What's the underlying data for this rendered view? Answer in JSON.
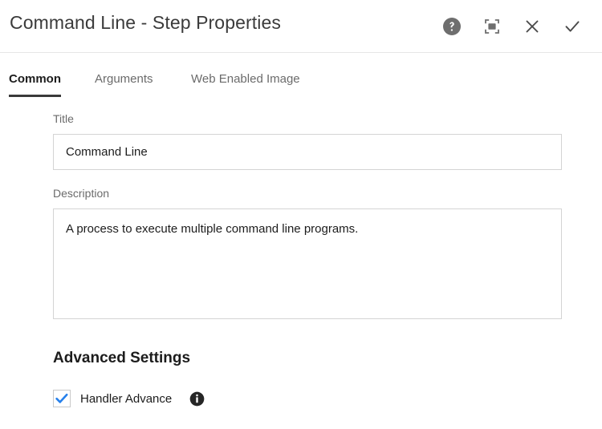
{
  "header": {
    "title": "Command Line - Step Properties",
    "actions": [
      {
        "name": "help-icon",
        "label": "Help"
      },
      {
        "name": "maximize-icon",
        "label": "Maximize"
      },
      {
        "name": "close-icon",
        "label": "Close"
      },
      {
        "name": "confirm-check-icon",
        "label": "Apply"
      }
    ]
  },
  "tabs": [
    {
      "label": "Common",
      "active": true
    },
    {
      "label": "Arguments",
      "active": false
    },
    {
      "label": "Web Enabled Image",
      "active": false
    }
  ],
  "form": {
    "title_label": "Title",
    "title_value": "Command Line",
    "title_placeholder": "",
    "description_label": "Description",
    "description_value": "A process to execute multiple command line programs.",
    "description_placeholder": ""
  },
  "advanced": {
    "heading": "Advanced Settings",
    "handler_advance_label": "Handler Advance",
    "handler_advance_checked": true,
    "info_tooltip_icon": "info-icon"
  },
  "colors": {
    "checkbox_check": "#2680eb",
    "icon_gray": "#6e6e6e",
    "icon_dark": "#2c2c2c",
    "border": "#d4d4d4",
    "tab_underline": "#3a3a3a"
  }
}
